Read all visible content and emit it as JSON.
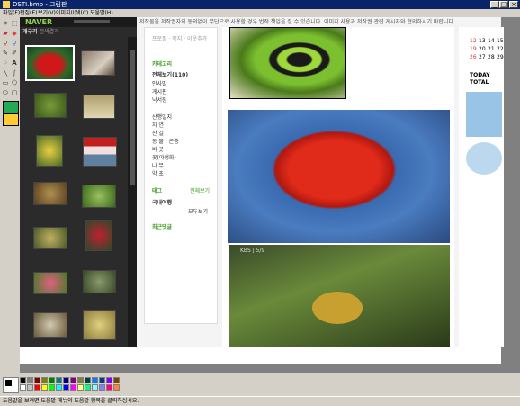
{
  "window": {
    "title": "DSTI.bmp - 그림판",
    "min_label": "_",
    "max_label": "□",
    "close_label": "×"
  },
  "menu": [
    {
      "label": "파일(F)"
    },
    {
      "label": "편집(E)"
    },
    {
      "label": "보기(V)"
    },
    {
      "label": "이미지(I)"
    },
    {
      "label": "색(C)"
    },
    {
      "label": "도움말(H)"
    }
  ],
  "left_panel": {
    "logo": "NAVER",
    "search_label": "개구리",
    "search_suffix": "검색결과"
  },
  "blog": {
    "notice": "저작물을 저작권자의 동의없이 무단으로 사용할 경우 법적 책임을 질 수 있습니다. 이미지 사용과 저작권 관련 게시자와 협의하시기 바랍니다.",
    "sidebar_top": "프로필 · 쪽지 · 이웃추가",
    "category_title": "카테고리",
    "all_posts": "전체보기(110)",
    "items_group1": [
      "인사말",
      "게시판",
      "낙서장"
    ],
    "items_group2": [
      "산행일지",
      "자 연",
      "산 길",
      "동 물 · 곤충",
      "비 곳",
      "꽃(야생화)",
      "나 무",
      "약 초"
    ],
    "tag_title": "태그",
    "tag_more": "전체보기",
    "tag_item": "국내여행",
    "tag_all": "모두보기",
    "recent_comments": "최근댓글",
    "watermark": "KBS | 5/9"
  },
  "calendar": {
    "row1": [
      "12",
      "13",
      "14",
      "15"
    ],
    "row2": [
      "19",
      "20",
      "21",
      "22"
    ],
    "row3": [
      "26",
      "27",
      "28",
      "29"
    ],
    "today_label": "TODAY",
    "total_label": "TOTAL"
  },
  "status": {
    "text": "도움말을 보려면 도움말 메뉴의 도움말 항목을 클릭하십시오."
  },
  "palette": [
    "#000000",
    "#808080",
    "#800000",
    "#808000",
    "#008000",
    "#008080",
    "#000080",
    "#800080",
    "#808040",
    "#004040",
    "#0080ff",
    "#004080",
    "#8000ff",
    "#804000",
    "#ffffff",
    "#c0c0c0",
    "#ff0000",
    "#ffff00",
    "#00ff00",
    "#00ffff",
    "#0000ff",
    "#ff00ff",
    "#ffff80",
    "#00ff80",
    "#80ffff",
    "#8080ff",
    "#ff0080",
    "#ff8040"
  ]
}
